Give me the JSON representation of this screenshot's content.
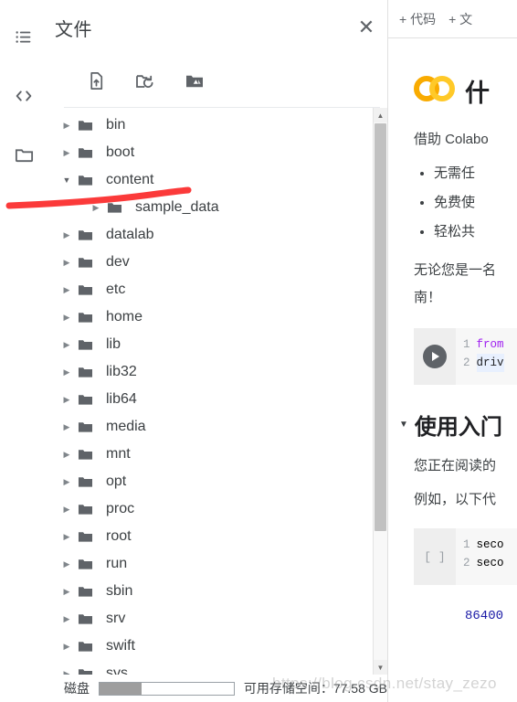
{
  "rail": {
    "items": [
      {
        "name": "toc-icon",
        "label": "目录"
      },
      {
        "name": "code-snippets-icon",
        "label": "代码段"
      },
      {
        "name": "files-icon",
        "label": "文件"
      }
    ]
  },
  "files_panel": {
    "title": "文件",
    "close_label": "✕",
    "toolbar": [
      {
        "name": "upload-file-icon",
        "label": "上传文件"
      },
      {
        "name": "refresh-folder-icon",
        "label": "刷新"
      },
      {
        "name": "mount-drive-icon",
        "label": "装载云端硬盘"
      }
    ],
    "tree": [
      {
        "label": "bin",
        "depth": 0,
        "expanded": false
      },
      {
        "label": "boot",
        "depth": 0,
        "expanded": false
      },
      {
        "label": "content",
        "depth": 0,
        "expanded": true
      },
      {
        "label": "sample_data",
        "depth": 1,
        "expanded": false
      },
      {
        "label": "datalab",
        "depth": 0,
        "expanded": false
      },
      {
        "label": "dev",
        "depth": 0,
        "expanded": false
      },
      {
        "label": "etc",
        "depth": 0,
        "expanded": false
      },
      {
        "label": "home",
        "depth": 0,
        "expanded": false
      },
      {
        "label": "lib",
        "depth": 0,
        "expanded": false
      },
      {
        "label": "lib32",
        "depth": 0,
        "expanded": false
      },
      {
        "label": "lib64",
        "depth": 0,
        "expanded": false
      },
      {
        "label": "media",
        "depth": 0,
        "expanded": false
      },
      {
        "label": "mnt",
        "depth": 0,
        "expanded": false
      },
      {
        "label": "opt",
        "depth": 0,
        "expanded": false
      },
      {
        "label": "proc",
        "depth": 0,
        "expanded": false
      },
      {
        "label": "root",
        "depth": 0,
        "expanded": false
      },
      {
        "label": "run",
        "depth": 0,
        "expanded": false
      },
      {
        "label": "sbin",
        "depth": 0,
        "expanded": false
      },
      {
        "label": "srv",
        "depth": 0,
        "expanded": false
      },
      {
        "label": "swift",
        "depth": 0,
        "expanded": false
      },
      {
        "label": "sys",
        "depth": 0,
        "expanded": false
      }
    ],
    "scrollbar": {
      "up_arrow": "▲",
      "down_arrow": "▼",
      "thumb_percent": 72
    },
    "status": {
      "disk_label": "磁盘",
      "disk_used_percent": 31,
      "free_space_text": "可用存储空间：77.58 GB"
    }
  },
  "notebook": {
    "toolbar": {
      "add_code": "+ 代码",
      "add_text": "+ 文"
    },
    "logo_text": "CO",
    "heading": "什",
    "intro": "借助 Colabo",
    "bullets": [
      "无需任",
      "免费使",
      "轻松共"
    ],
    "paragraph_lines": [
      "无论您是一名",
      "南！"
    ],
    "code_cell_1": {
      "run_label": "▶",
      "lines": [
        {
          "num": "1",
          "kw": "from",
          "rest": ""
        },
        {
          "num": "2",
          "kw": "",
          "rest": "driv"
        }
      ]
    },
    "section": {
      "triangle": "▼",
      "title": "使用入门",
      "lines": [
        "您正在阅读的",
        "例如，以下代"
      ]
    },
    "code_cell_2": {
      "prompt": "[ ]",
      "lines": [
        {
          "num": "1",
          "text": "seco"
        },
        {
          "num": "2",
          "text": "seco"
        }
      ],
      "output": "86400"
    }
  },
  "overlay": {
    "watermark": "https://blog.csdn.net/stay_zezo",
    "annotation_color": "#FB3A3A"
  },
  "colors": {
    "logo_left": "#F9AB00",
    "logo_right": "#FFC928",
    "text": "#3c4043",
    "icon": "#5f6368"
  }
}
